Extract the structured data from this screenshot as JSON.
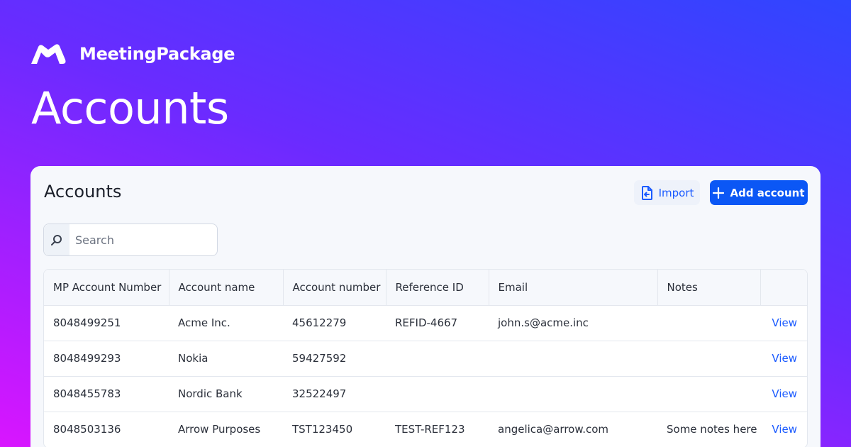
{
  "brand": {
    "name": "MeetingPackage",
    "logo_icon": "meetingpackage-logo-icon"
  },
  "hero": {
    "title": "Accounts"
  },
  "card": {
    "title": "Accounts",
    "import_label": "Import",
    "import_icon": "file-import-icon",
    "add_label": "Add account",
    "add_icon": "plus-icon",
    "accent_color": "#0b57f5"
  },
  "search": {
    "placeholder": "Search",
    "value": "",
    "icon": "search-icon"
  },
  "table": {
    "columns": [
      "MP Account Number",
      "Account name",
      "Account number",
      "Reference ID",
      "Email",
      "Notes",
      ""
    ],
    "rows": [
      {
        "mp_number": "8048499251",
        "name": "Acme Inc.",
        "account_number": "45612279",
        "reference_id": "REFID-4667",
        "email": "john.s@acme.inc",
        "notes": "",
        "action": "View"
      },
      {
        "mp_number": "8048499293",
        "name": "Nokia",
        "account_number": "59427592",
        "reference_id": "",
        "email": "",
        "notes": "",
        "action": "View"
      },
      {
        "mp_number": "8048455783",
        "name": "Nordic Bank",
        "account_number": "32522497",
        "reference_id": "",
        "email": "",
        "notes": "",
        "action": "View"
      },
      {
        "mp_number": "8048503136",
        "name": "Arrow Purposes",
        "account_number": "TST123450",
        "reference_id": "TEST-REF123",
        "email": "angelica@arrow.com",
        "notes": "Some notes here",
        "action": "View"
      }
    ]
  }
}
